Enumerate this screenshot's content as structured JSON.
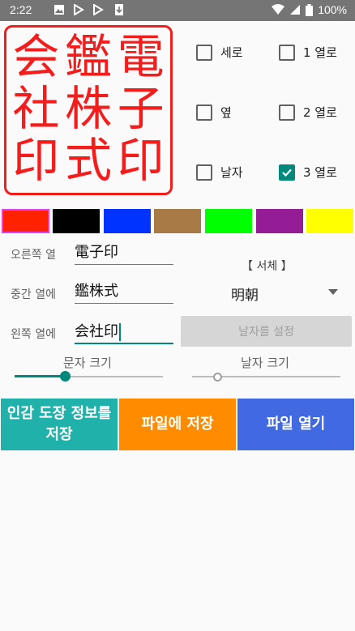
{
  "status": {
    "time": "2:22",
    "battery": "100%"
  },
  "seal": {
    "color": "#f51c1c",
    "columns": [
      [
        "会",
        "社",
        "印"
      ],
      [
        "鑑",
        "株",
        "式"
      ],
      [
        "電",
        "子",
        "印"
      ]
    ]
  },
  "options": {
    "vertical": {
      "label": "세로",
      "checked": false
    },
    "horizontal": {
      "label": "옆",
      "checked": false
    },
    "date": {
      "label": "날자",
      "checked": false
    },
    "col1": {
      "label": "1 열로",
      "checked": false
    },
    "col2": {
      "label": "2 열로",
      "checked": false
    },
    "col3": {
      "label": "3 열로",
      "checked": true
    }
  },
  "colors": [
    "#ff2200",
    "#000000",
    "#0033ff",
    "#a87a45",
    "#00ff00",
    "#941c94",
    "#ffff00"
  ],
  "form": {
    "right_label": "오른쪽 열",
    "right_value": "電子印",
    "middle_label": "중간 열에",
    "middle_value": "鑑株式",
    "left_label": "왼쪽 열에",
    "left_value": "会社印",
    "font_label": "【 서체 】",
    "font_value": "明朝",
    "set_date_button": "날자를 설정"
  },
  "sliders": {
    "char_size_label": "문자 크기",
    "char_size_fraction": 0.34,
    "date_size_label": "날자 크기",
    "date_size_fraction": 0.17
  },
  "buttons": {
    "save_info": "인감 도장 정보를 저장",
    "save_file": "파일에 저장",
    "open_file": "파일 열기"
  }
}
